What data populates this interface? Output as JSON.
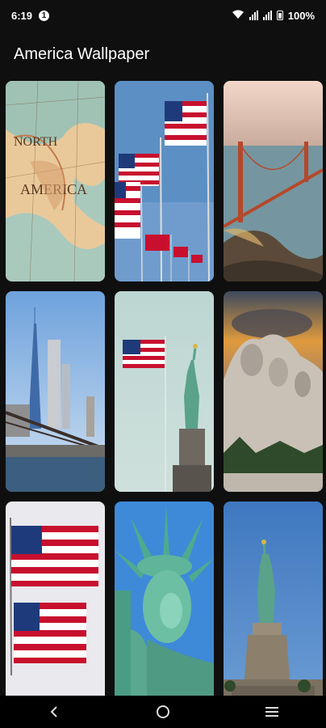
{
  "status_bar": {
    "time": "6:19",
    "notification_badge": "1",
    "battery": "100%"
  },
  "app": {
    "title": "America Wallpaper"
  },
  "wallpapers": [
    {
      "subject": "vintage-map-america",
      "icon": "map-image"
    },
    {
      "subject": "us-flags-on-poles",
      "icon": "flag-image"
    },
    {
      "subject": "golden-gate-bridge",
      "icon": "bridge-image"
    },
    {
      "subject": "new-york-skyline-bridge",
      "icon": "skyline-image"
    },
    {
      "subject": "flag-and-statue-of-liberty",
      "icon": "statue-image"
    },
    {
      "subject": "mount-rushmore",
      "icon": "monument-image"
    },
    {
      "subject": "two-us-flags",
      "icon": "flag-image"
    },
    {
      "subject": "statue-of-liberty-face",
      "icon": "statue-image"
    },
    {
      "subject": "statue-of-liberty-full",
      "icon": "statue-image"
    }
  ],
  "nav": {
    "back": "back-icon",
    "home": "home-icon",
    "recents": "recents-icon"
  },
  "colors": {
    "background": "#0f0f0f",
    "navbar": "#000000",
    "text": "#ffffff"
  }
}
